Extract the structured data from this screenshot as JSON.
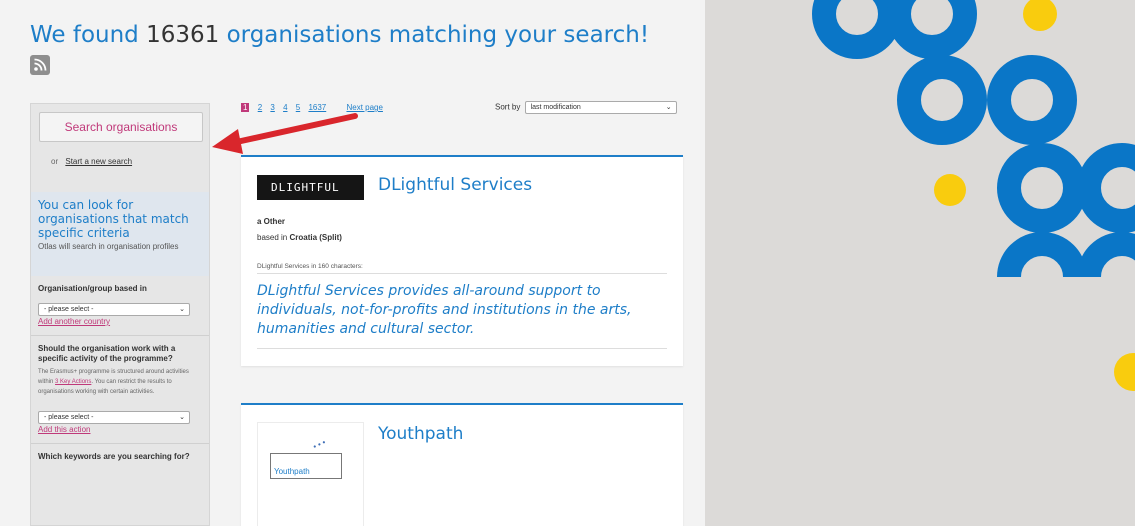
{
  "header": {
    "title_prefix": "We found",
    "count": "16361",
    "title_suffix": "organisations matching your search!"
  },
  "sidebar": {
    "search_button": "Search organisations",
    "or_text": "or",
    "new_search_link": "Start a new search",
    "criteria_heading": "You can look for organisations that match specific criteria",
    "criteria_sub": "Otlas will search in organisation profiles",
    "filter_country": {
      "label": "Organisation/group based in",
      "select": "- please select -",
      "add_link": "Add another country"
    },
    "filter_activity": {
      "label": "Should the organisation work with a specific activity of the programme?",
      "desc_before": "The Erasmus+ programme is structured around activities within",
      "desc_link": "3 Key Actions",
      "desc_after": ". You can restrict the results to organisations working with certain activities.",
      "select": "- please select -",
      "add_link": "Add this action"
    },
    "filter_keywords": {
      "label": "Which keywords are you searching for?"
    }
  },
  "pagination": {
    "pages": [
      "1",
      "2",
      "3",
      "4",
      "5"
    ],
    "last": "1637",
    "next_label": "Next page"
  },
  "sort": {
    "label": "Sort by",
    "value": "last modification"
  },
  "results": [
    {
      "logo_text": "DLIGHTFUL",
      "title": "DLightful Services",
      "type": "a Other",
      "based_prefix": "based in",
      "based_location": "Croatia (Split)",
      "chars_label": "DLightful Services in 160 characters:",
      "description": "DLightful Services provides all-around support to individuals, not-for-profits and institutions in the arts, humanities and cultural sector."
    },
    {
      "logo_text": "Youthpath",
      "title": "Youthpath"
    }
  ],
  "colors": {
    "brand_blue": "#1e7ec8",
    "link_magenta": "#c0397a",
    "deco_blue": "#0a76c7",
    "deco_yellow": "#f9cc0e",
    "arrow_red": "#d9262c"
  },
  "icons": {
    "rss": "rss-feed-icon",
    "annotation": "red-arrow-annotation"
  }
}
